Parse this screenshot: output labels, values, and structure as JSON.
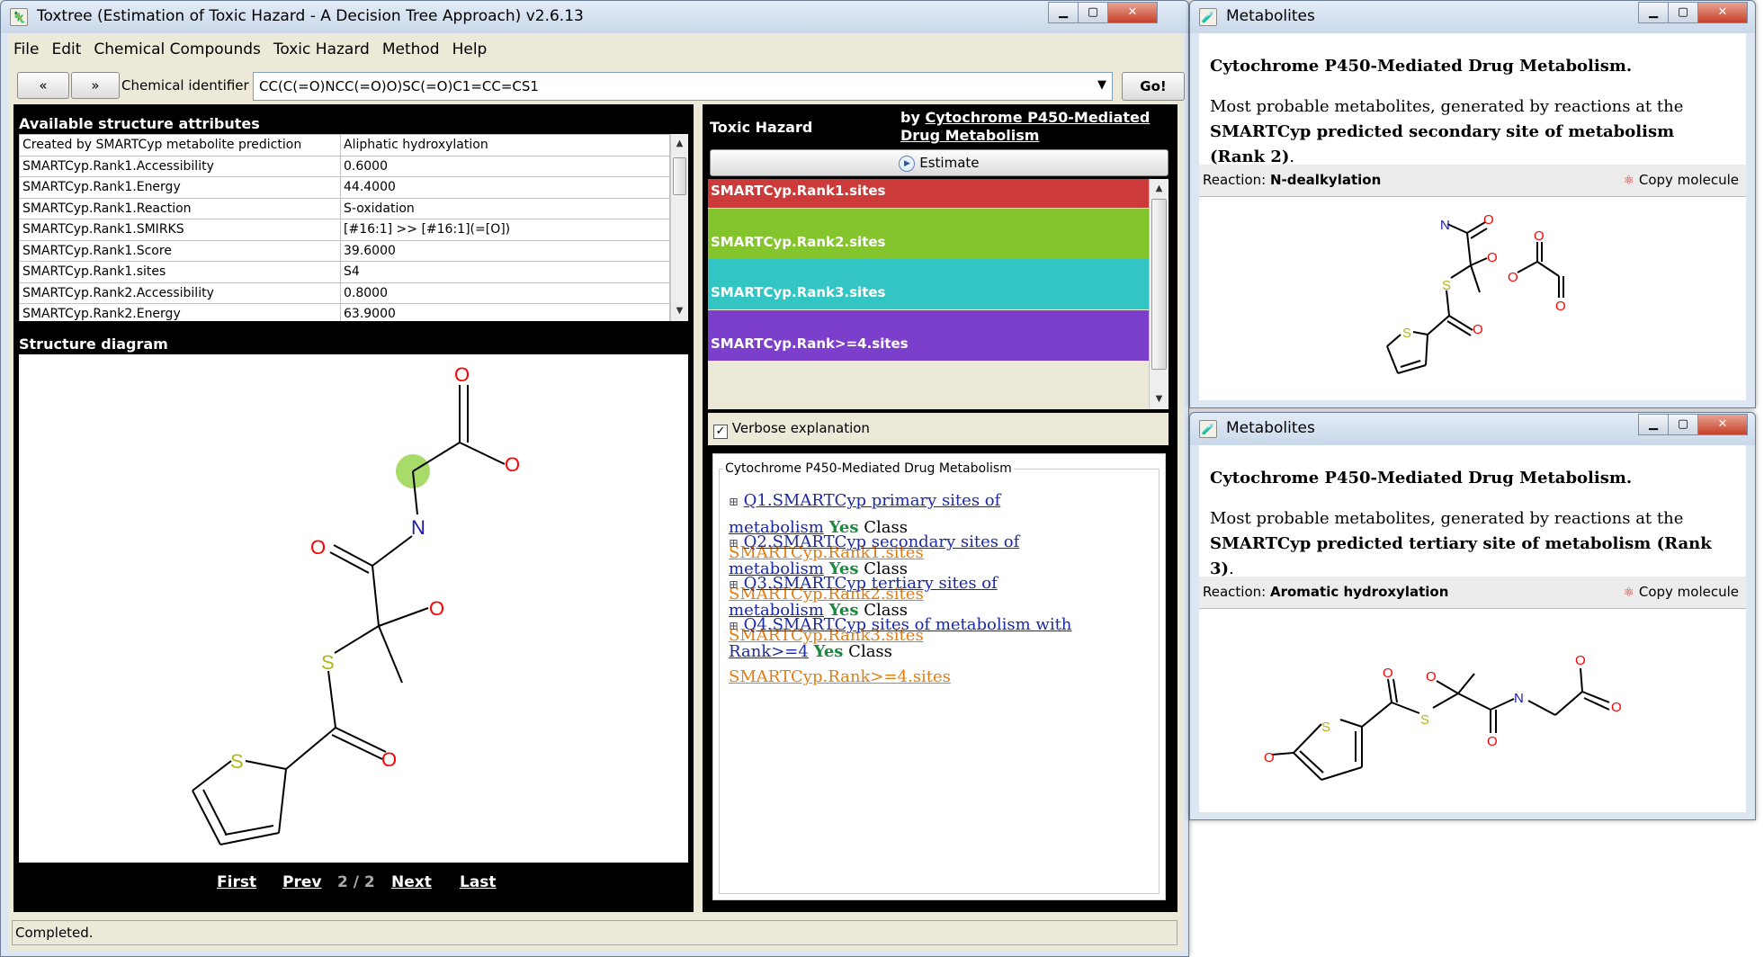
{
  "main": {
    "title": "Toxtree (Estimation of Toxic Hazard - A Decision Tree Approach) v2.6.13",
    "menu": [
      "File",
      "Edit",
      "Chemical Compounds",
      "Toxic Hazard",
      "Method",
      "Help"
    ],
    "nav_prev": "«",
    "nav_next": "»",
    "identifier_label": "Chemical identifier",
    "identifier_value": "CC(C(=O)NCC(=O)O)SC(=O)C1=CC=CS1",
    "go_label": "Go!",
    "attributes_header": "Available structure attributes",
    "attributes": [
      [
        "Created by SMARTCyp metabolite prediction",
        "Aliphatic hydroxylation"
      ],
      [
        "SMARTCyp.Rank1.Accessibility",
        "0.6000"
      ],
      [
        "SMARTCyp.Rank1.Energy",
        "44.4000"
      ],
      [
        "SMARTCyp.Rank1.Reaction",
        "S-oxidation"
      ],
      [
        "SMARTCyp.Rank1.SMIRKS",
        "[#16:1] >> [#16:1](=[O])"
      ],
      [
        "SMARTCyp.Rank1.Score",
        "39.6000"
      ],
      [
        "SMARTCyp.Rank1.sites",
        "S4"
      ],
      [
        "SMARTCyp.Rank2.Accessibility",
        "0.8000"
      ],
      [
        "SMARTCyp.Rank2.Energy",
        "63.9000"
      ]
    ],
    "structure_header": "Structure diagram",
    "pager": {
      "first": "First",
      "prev": "Prev",
      "position": "2 / 2",
      "next": "Next",
      "last": "Last"
    },
    "hazard_label": "Toxic Hazard",
    "hazard_by": "by",
    "hazard_method": "Cytochrome P450-Mediated Drug Metabolism",
    "estimate_label": "Estimate",
    "hazard_bars": [
      {
        "label": "SMARTCyp.Rank1.sites",
        "color": "#cc3a3a"
      },
      {
        "label": "SMARTCyp.Rank2.sites",
        "color": "#84c42d"
      },
      {
        "label": "SMARTCyp.Rank3.sites",
        "color": "#33c4c4"
      },
      {
        "label": "SMARTCyp.Rank>=4.sites",
        "color": "#7b3fcc"
      }
    ],
    "verbose_label": "Verbose explanation",
    "verbose_checked": true,
    "explanation_title": "Cytochrome P450-Mediated Drug Metabolism",
    "questions": [
      {
        "q1": "Q1.SMARTCyp primary sites of",
        "q2": "metabolism",
        "ans": "Yes",
        "cls_word": "Class",
        "cls": "SMARTCyp.Rank1.sites"
      },
      {
        "q1": "Q2.SMARTCyp secondary sites of",
        "q2": "metabolism",
        "ans": "Yes",
        "cls_word": "Class",
        "cls": "SMARTCyp.Rank2.sites"
      },
      {
        "q1": "Q3.SMARTCyp tertiary sites of",
        "q2": "metabolism",
        "ans": "Yes",
        "cls_word": "Class",
        "cls": "SMARTCyp.Rank3.sites"
      },
      {
        "q1": "Q4.SMARTCyp sites of metabolism with",
        "q2": "Rank>=4",
        "ans": "Yes",
        "cls_word": "Class",
        "cls": "SMARTCyp.Rank>=4.sites"
      }
    ],
    "status": "Completed."
  },
  "metabolites": [
    {
      "title": "Metabolites",
      "heading": "Cytochrome P450-Mediated Drug Metabolism.",
      "desc_pre": "Most probable metabolites, generated by reactions at the",
      "desc_bold": "SMARTCyp predicted secondary site of metabolism (Rank 2)",
      "desc_post": ".",
      "reaction_label": "Reaction:",
      "reaction": "N-dealkylation",
      "copy_label": "Copy molecule"
    },
    {
      "title": "Metabolites",
      "heading": "Cytochrome P450-Mediated Drug Metabolism.",
      "desc_pre": "Most probable metabolites, generated by reactions at the",
      "desc_bold": "SMARTCyp predicted tertiary site of metabolism (Rank 3)",
      "desc_post": ".",
      "reaction_label": "Reaction:",
      "reaction": "Aromatic hydroxylation",
      "copy_label": "Copy molecule"
    }
  ],
  "atoms": {
    "O": "O",
    "N": "N",
    "S": "S"
  },
  "colors": {
    "oxygen": "#ff0000",
    "nitrogen": "#1a1aaa",
    "sulfur": "#b5b514",
    "highlight": "#a8dc6a"
  }
}
